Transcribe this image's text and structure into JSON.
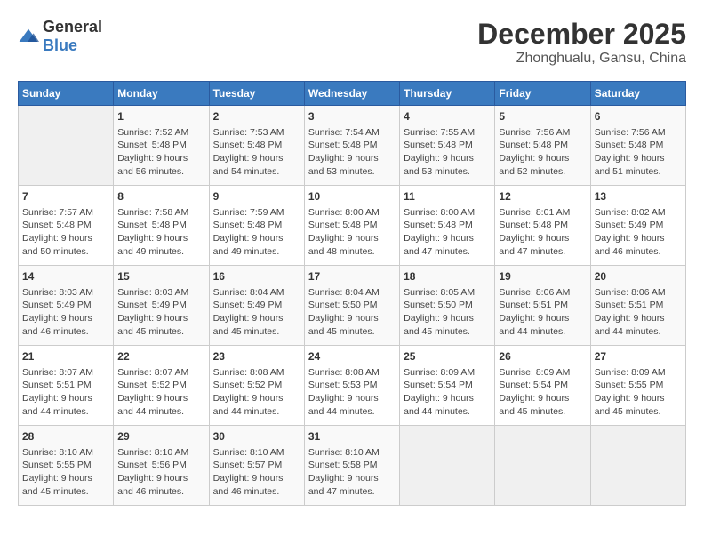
{
  "header": {
    "logo_general": "General",
    "logo_blue": "Blue",
    "month_year": "December 2025",
    "location": "Zhonghualu, Gansu, China"
  },
  "days_of_week": [
    "Sunday",
    "Monday",
    "Tuesday",
    "Wednesday",
    "Thursday",
    "Friday",
    "Saturday"
  ],
  "weeks": [
    [
      {
        "day": "",
        "info": ""
      },
      {
        "day": "1",
        "info": "Sunrise: 7:52 AM\nSunset: 5:48 PM\nDaylight: 9 hours\nand 56 minutes."
      },
      {
        "day": "2",
        "info": "Sunrise: 7:53 AM\nSunset: 5:48 PM\nDaylight: 9 hours\nand 54 minutes."
      },
      {
        "day": "3",
        "info": "Sunrise: 7:54 AM\nSunset: 5:48 PM\nDaylight: 9 hours\nand 53 minutes."
      },
      {
        "day": "4",
        "info": "Sunrise: 7:55 AM\nSunset: 5:48 PM\nDaylight: 9 hours\nand 53 minutes."
      },
      {
        "day": "5",
        "info": "Sunrise: 7:56 AM\nSunset: 5:48 PM\nDaylight: 9 hours\nand 52 minutes."
      },
      {
        "day": "6",
        "info": "Sunrise: 7:56 AM\nSunset: 5:48 PM\nDaylight: 9 hours\nand 51 minutes."
      }
    ],
    [
      {
        "day": "7",
        "info": "Sunrise: 7:57 AM\nSunset: 5:48 PM\nDaylight: 9 hours\nand 50 minutes."
      },
      {
        "day": "8",
        "info": "Sunrise: 7:58 AM\nSunset: 5:48 PM\nDaylight: 9 hours\nand 49 minutes."
      },
      {
        "day": "9",
        "info": "Sunrise: 7:59 AM\nSunset: 5:48 PM\nDaylight: 9 hours\nand 49 minutes."
      },
      {
        "day": "10",
        "info": "Sunrise: 8:00 AM\nSunset: 5:48 PM\nDaylight: 9 hours\nand 48 minutes."
      },
      {
        "day": "11",
        "info": "Sunrise: 8:00 AM\nSunset: 5:48 PM\nDaylight: 9 hours\nand 47 minutes."
      },
      {
        "day": "12",
        "info": "Sunrise: 8:01 AM\nSunset: 5:48 PM\nDaylight: 9 hours\nand 47 minutes."
      },
      {
        "day": "13",
        "info": "Sunrise: 8:02 AM\nSunset: 5:49 PM\nDaylight: 9 hours\nand 46 minutes."
      }
    ],
    [
      {
        "day": "14",
        "info": "Sunrise: 8:03 AM\nSunset: 5:49 PM\nDaylight: 9 hours\nand 46 minutes."
      },
      {
        "day": "15",
        "info": "Sunrise: 8:03 AM\nSunset: 5:49 PM\nDaylight: 9 hours\nand 45 minutes."
      },
      {
        "day": "16",
        "info": "Sunrise: 8:04 AM\nSunset: 5:49 PM\nDaylight: 9 hours\nand 45 minutes."
      },
      {
        "day": "17",
        "info": "Sunrise: 8:04 AM\nSunset: 5:50 PM\nDaylight: 9 hours\nand 45 minutes."
      },
      {
        "day": "18",
        "info": "Sunrise: 8:05 AM\nSunset: 5:50 PM\nDaylight: 9 hours\nand 45 minutes."
      },
      {
        "day": "19",
        "info": "Sunrise: 8:06 AM\nSunset: 5:51 PM\nDaylight: 9 hours\nand 44 minutes."
      },
      {
        "day": "20",
        "info": "Sunrise: 8:06 AM\nSunset: 5:51 PM\nDaylight: 9 hours\nand 44 minutes."
      }
    ],
    [
      {
        "day": "21",
        "info": "Sunrise: 8:07 AM\nSunset: 5:51 PM\nDaylight: 9 hours\nand 44 minutes."
      },
      {
        "day": "22",
        "info": "Sunrise: 8:07 AM\nSunset: 5:52 PM\nDaylight: 9 hours\nand 44 minutes."
      },
      {
        "day": "23",
        "info": "Sunrise: 8:08 AM\nSunset: 5:52 PM\nDaylight: 9 hours\nand 44 minutes."
      },
      {
        "day": "24",
        "info": "Sunrise: 8:08 AM\nSunset: 5:53 PM\nDaylight: 9 hours\nand 44 minutes."
      },
      {
        "day": "25",
        "info": "Sunrise: 8:09 AM\nSunset: 5:54 PM\nDaylight: 9 hours\nand 44 minutes."
      },
      {
        "day": "26",
        "info": "Sunrise: 8:09 AM\nSunset: 5:54 PM\nDaylight: 9 hours\nand 45 minutes."
      },
      {
        "day": "27",
        "info": "Sunrise: 8:09 AM\nSunset: 5:55 PM\nDaylight: 9 hours\nand 45 minutes."
      }
    ],
    [
      {
        "day": "28",
        "info": "Sunrise: 8:10 AM\nSunset: 5:55 PM\nDaylight: 9 hours\nand 45 minutes."
      },
      {
        "day": "29",
        "info": "Sunrise: 8:10 AM\nSunset: 5:56 PM\nDaylight: 9 hours\nand 46 minutes."
      },
      {
        "day": "30",
        "info": "Sunrise: 8:10 AM\nSunset: 5:57 PM\nDaylight: 9 hours\nand 46 minutes."
      },
      {
        "day": "31",
        "info": "Sunrise: 8:10 AM\nSunset: 5:58 PM\nDaylight: 9 hours\nand 47 minutes."
      },
      {
        "day": "",
        "info": ""
      },
      {
        "day": "",
        "info": ""
      },
      {
        "day": "",
        "info": ""
      }
    ]
  ]
}
